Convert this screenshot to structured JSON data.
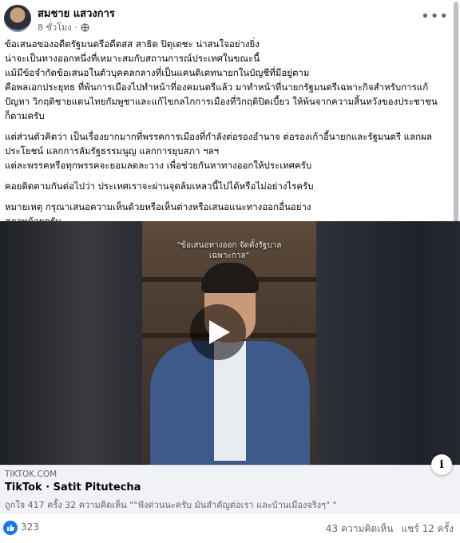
{
  "post": {
    "author": "สมชาย แสวงการ",
    "time": "8 ชั่วโมง",
    "paragraphs": [
      "ข้อเสนอของอดีตรัฐมนตรีอดีตสส  สาธิต ปิตุเตชะ น่าสนใจอย่างยิ่ง\nน่าจะเป็นทางออกหนึ่งที่เหมาะสมกับสถานการณ์ประเทศในขณะนี้\nแม้มีข้อจำกัดข้อเสนอในตัวบุคคลกลางที่เป็นแคนดิเดทนายกในบัญชีที่มีอยู่ตาม\nคือพลเอกประยุทธ ที่พ้นการเมืองไปทำหน้าที่องคมนตรีแล้ว มาทำหน้าที่นายกรัฐมนตรีเฉพาะกิจสำหรับการแก้\nปัญหา วิกฤติชายแดนไทยกัมพูชาและแก้ไขกลไกการเมืองที่วิกฤติปิดเบี้ยว ให้พ้นจากความสิ้นหวังของประชาชน\nก็ตามครับ",
      "แต่ส่วนตัวคิดว่า เป็นเรื่องยากมากที่พรรคการเมืองที่กำลังต่อรองอำนาจ ต่อรองเก้าอี้นายกและรัฐมนตรี แลกผล\nประโยชน์ แลกการลัมรัฐธรรมนูญ แลกการยุบสภา ฯลฯ\nแต่ละพรรคหรือทุกพรรคจะยอมลดละวาง เพื่อช่วยกันหาทางออกให้ประเทศครับ",
      "คอยติดตามกันต่อไปว่า ประเทศเราจะผ่านจุดล้มเหลวนี้ไปได้หรือไม่อย่างไรครับ",
      "หมายเหตุ กรุณาเสนอความเห็นด้วยหรือเห็นต่างหรือเสนอแนะทางออกอื่นอย่าง\nสุภาพด้วยครับ"
    ]
  },
  "video": {
    "caption": "\"ข้อเสนอทางออก จัดตั้งรัฐบาล\nเฉพาะกาล\""
  },
  "link": {
    "domain": "TIKTOK.COM",
    "title": "TikTok · Satit Pitutecha",
    "description": "ถูกใจ 417 ครั้ง 32 ความคิดเห็น \"\"ฟังด่วนนะครับ มันสำคัญต่อเรา และบ้านเมืองจริงๆ\" \""
  },
  "footer": {
    "likes": "323",
    "comments": "43 ความคิดเห็น",
    "shares": "แชร์ 12 ครั้ง"
  },
  "colors": {
    "accent": "#1877f2",
    "muted": "#65676b",
    "link_bg": "#f0f2f5"
  },
  "icons": [
    "globe-icon",
    "more-options-icon",
    "play-icon",
    "info-icon",
    "like-icon"
  ]
}
